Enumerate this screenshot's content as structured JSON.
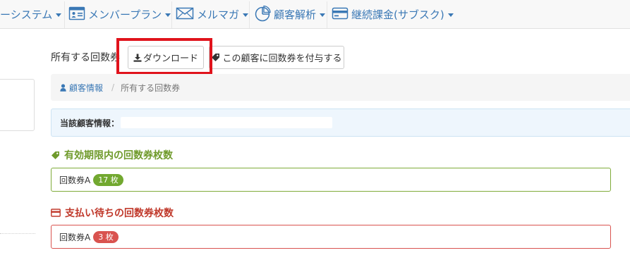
{
  "colors": {
    "link": "#3a78b5",
    "valid": "#6f9a2b",
    "pending": "#c0392b",
    "highlight": "#e0131c"
  },
  "nav": {
    "items": [
      {
        "label": "ーシステム",
        "icon": "none"
      },
      {
        "label": "メンバープラン",
        "icon": "member-card-icon"
      },
      {
        "label": "メルマガ",
        "icon": "envelope-icon"
      },
      {
        "label": "顧客解析",
        "icon": "pie-chart-icon"
      },
      {
        "label": "継続課金(サブスク)",
        "icon": "credit-card-icon"
      }
    ]
  },
  "header": {
    "title": "所有する回数券",
    "download_label": "ダウンロード",
    "grant_label": "この顧客に回数券を付与する"
  },
  "breadcrumb": {
    "parent": "顧客情報",
    "separator": "/",
    "current": "所有する回数券"
  },
  "info": {
    "label": "当該顧客情報："
  },
  "sections": {
    "valid": {
      "title": "有効期限内の回数券枚数",
      "item_name": "回数券A",
      "count": "17 枚"
    },
    "pending": {
      "title": "支払い待ちの回数券枚数",
      "item_name": "回数券A",
      "count": "3 枚"
    }
  }
}
